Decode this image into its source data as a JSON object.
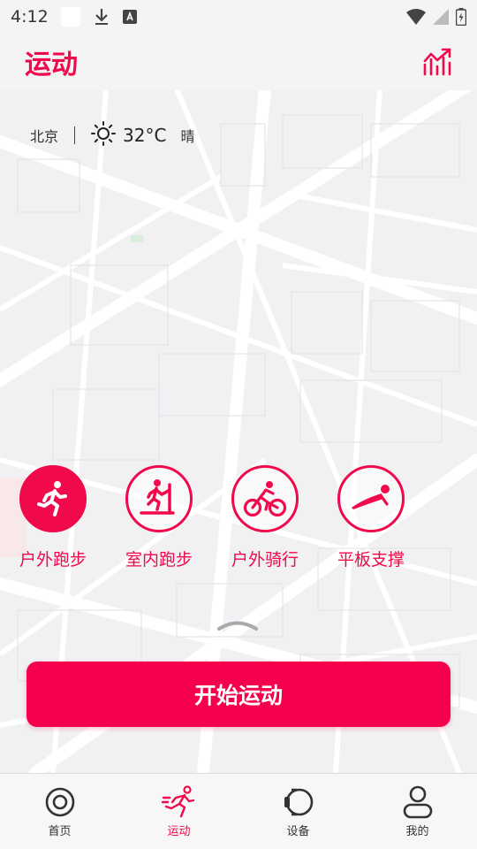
{
  "status_bar": {
    "time": "4:12"
  },
  "header": {
    "title": "运动"
  },
  "weather": {
    "city": "北京",
    "temperature": "32°C",
    "condition": "晴"
  },
  "sports": [
    {
      "label": "户外跑步",
      "icon": "outdoor-run-icon",
      "active": true
    },
    {
      "label": "室内跑步",
      "icon": "treadmill-icon",
      "active": false
    },
    {
      "label": "户外骑行",
      "icon": "bicycle-icon",
      "active": false
    },
    {
      "label": "平板支撑",
      "icon": "plank-icon",
      "active": false
    }
  ],
  "start_button": {
    "label": "开始运动"
  },
  "bottom_nav": [
    {
      "label": "首页",
      "icon": "home-icon",
      "active": false
    },
    {
      "label": "运动",
      "icon": "sport-icon",
      "active": true
    },
    {
      "label": "设备",
      "icon": "watch-icon",
      "active": false
    },
    {
      "label": "我的",
      "icon": "profile-icon",
      "active": false
    }
  ],
  "colors": {
    "accent": "#f0094b",
    "button": "#f5004c",
    "background": "#f4f4f5",
    "map_road": "#ffffff"
  }
}
